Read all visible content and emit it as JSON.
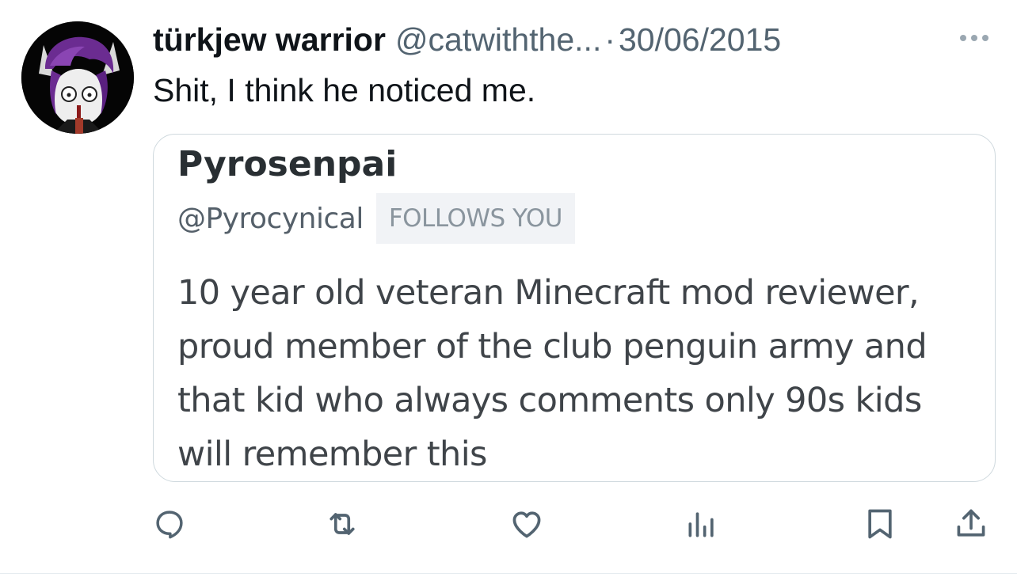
{
  "tweet": {
    "display_name": "türkjew warrior",
    "handle": "@catwiththe...",
    "separator": "·",
    "date": "30/06/2015",
    "text": "Shit, I think he noticed me.",
    "more_icon": "more-horizontal-icon"
  },
  "quoted_profile": {
    "name": "Pyrosenpai",
    "handle": "@Pyrocynical",
    "follows_badge": "FOLLOWS YOU",
    "bio_lines": [
      "10 year old veteran Minecraft mod reviewer,",
      "proud member of the club penguin army and",
      "that kid who always comments only 90s kids",
      "will remember this"
    ]
  },
  "actions": [
    {
      "icon": "reply-icon"
    },
    {
      "icon": "retweet-icon"
    },
    {
      "icon": "like-icon"
    },
    {
      "icon": "views-icon"
    },
    {
      "icon": "bookmark-icon"
    },
    {
      "icon": "share-icon"
    }
  ],
  "colors": {
    "primary_text": "#0f1419",
    "secondary_text": "#536471",
    "border": "#cfd9de",
    "avatar_purple": "#6b2c91"
  }
}
